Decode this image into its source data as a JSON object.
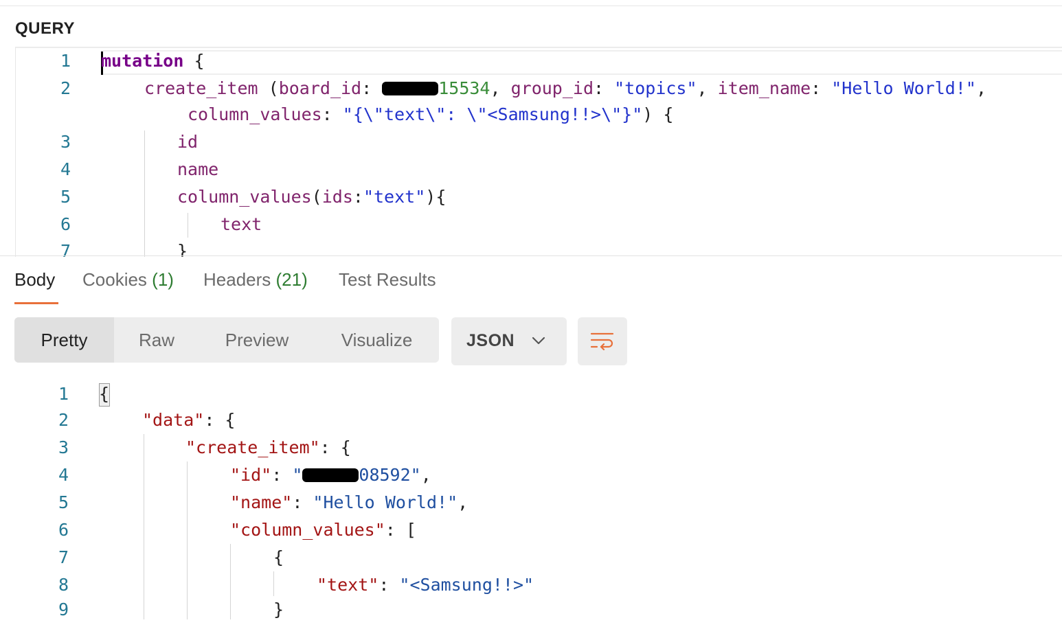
{
  "query_section": {
    "label": "QUERY",
    "line_numbers": [
      "1",
      "2",
      "3",
      "4",
      "5",
      "6",
      "7"
    ],
    "line1": {
      "keyword": "mutation",
      "brace": " {"
    },
    "line2": {
      "fn": "create_item",
      "open": " (",
      "param1": "board_id",
      "colon1": ": ",
      "board_id_visible_suffix": "15534",
      "comma1": ", ",
      "param2": "group_id",
      "colon2": ": ",
      "group_value": "\"topics\"",
      "comma2": ", ",
      "param3": "item_name",
      "colon3": ": ",
      "item_value": "\"Hello World!\"",
      "comma3": ","
    },
    "line2b": {
      "param": "column_values",
      "colon": ": ",
      "value": "\"{\\\"text\\\": \\\"<Samsung!!>\\\"}\"",
      "close": ") {"
    },
    "line3": "id",
    "line4": "name",
    "line5": {
      "fn": "column_values",
      "open": "(",
      "arg": "ids",
      "colon": ":",
      "value": "\"text\"",
      "close": "){"
    },
    "line6": "text",
    "line7": "}"
  },
  "response_tabs": [
    {
      "label": "Body",
      "count": ""
    },
    {
      "label": "Cookies",
      "count": "(1)"
    },
    {
      "label": "Headers",
      "count": "(21)"
    },
    {
      "label": "Test Results",
      "count": ""
    }
  ],
  "view_modes": [
    "Pretty",
    "Raw",
    "Preview",
    "Visualize"
  ],
  "format_dropdown": {
    "selected": "JSON"
  },
  "response_body": {
    "line_numbers": [
      "1",
      "2",
      "3",
      "4",
      "5",
      "6",
      "7",
      "8",
      "9"
    ],
    "l1": "{",
    "l2": {
      "key": "\"data\"",
      "rest": ": {"
    },
    "l3": {
      "key": "\"create_item\"",
      "rest": ": {"
    },
    "l4": {
      "key": "\"id\"",
      "colon": ": ",
      "value_open": "\"",
      "value_suffix": "08592\"",
      "comma": ","
    },
    "l5": {
      "key": "\"name\"",
      "colon": ": ",
      "value": "\"Hello World!\"",
      "comma": ","
    },
    "l6": {
      "key": "\"column_values\"",
      "rest": ": ["
    },
    "l7": "{",
    "l8": {
      "key": "\"text\"",
      "colon": ": ",
      "value": "\"<Samsung!!>\""
    },
    "l9": "}"
  },
  "colors": {
    "accent": "#e8703a",
    "count_green": "#2f7d32"
  }
}
